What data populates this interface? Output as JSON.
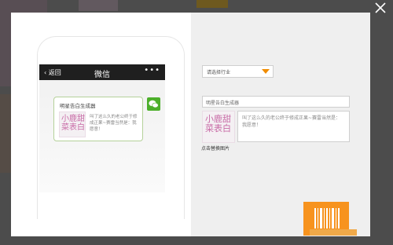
{
  "modal": {
    "close_icon": "close-icon"
  },
  "phone": {
    "navbar": {
      "back_label": "返回",
      "title": "微信",
      "more_label": "•••"
    },
    "message": {
      "title": "明星告白生成器",
      "thumb_text": "小鹿甜菜表白",
      "description": "叫了这么久的老公终于修成正果~赛雷当然是：我愿意！",
      "avatar_icon": "wechat-icon"
    }
  },
  "form": {
    "industry_select": {
      "selected": "请选择行业"
    },
    "title_field": {
      "value": "明星告白生成器"
    },
    "description_field": {
      "value": "叫了这么久的老公终于修成正果~赛雷当然是：我愿意！"
    },
    "change_image_label": "点击替换图片",
    "generate_button_icon": "barcode-icon"
  },
  "colors": {
    "accent_orange": "#f7931e",
    "wechat_green": "#4caf2a",
    "navbar_black": "#1f1f1f"
  }
}
